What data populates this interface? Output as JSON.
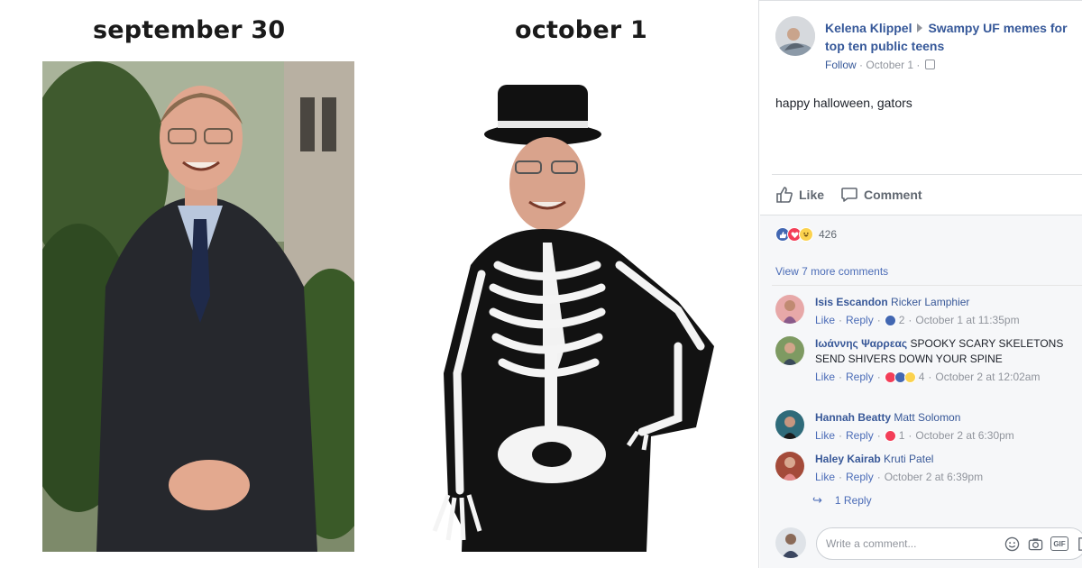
{
  "meme": {
    "caption_left": "september 30",
    "caption_right": "october 1"
  },
  "post": {
    "author": "Kelena Klippel",
    "group": "Swampy UF memes for top ten public teens",
    "follow_label": "Follow",
    "date": "October 1",
    "text": "happy halloween, gators",
    "like_label": "Like",
    "comment_label": "Comment",
    "reaction_count": "426",
    "view_more": "View 7 more comments"
  },
  "comments": [
    {
      "name": "Isis Escandon",
      "text": "Ricker Lamphier",
      "text_is_tag": true,
      "like": "Like",
      "reply": "Reply",
      "reactions": [
        "like"
      ],
      "count": "2",
      "time": "October 1 at 11:35pm"
    },
    {
      "name": "Ιωάννης Ψαρρεας",
      "text": "SPOOKY SCARY SKELETONS SEND SHIVERS DOWN YOUR SPINE",
      "text_is_tag": false,
      "like": "Like",
      "reply": "Reply",
      "reactions": [
        "love",
        "like",
        "haha"
      ],
      "count": "4",
      "time": "October 2 at 12:02am"
    },
    {
      "name": "Hannah Beatty",
      "text": "Matt Solomon",
      "text_is_tag": true,
      "like": "Like",
      "reply": "Reply",
      "reactions": [
        "love"
      ],
      "count": "1",
      "time": "October 2 at 6:30pm"
    },
    {
      "name": "Haley Kairab",
      "text": "Kruti Patel",
      "text_is_tag": true,
      "like": "Like",
      "reply": "Reply",
      "reactions": [],
      "count": "",
      "time": "October 2 at 6:39pm"
    }
  ],
  "reply_link": "1 Reply",
  "composer": {
    "placeholder": "Write a comment..."
  },
  "colors": {
    "link": "#365899",
    "meta": "#90949c",
    "panel_bg": "#f6f7f9",
    "like_blue": "#4267b2",
    "love_red": "#f33e58",
    "haha_yellow": "#fbd24e"
  }
}
